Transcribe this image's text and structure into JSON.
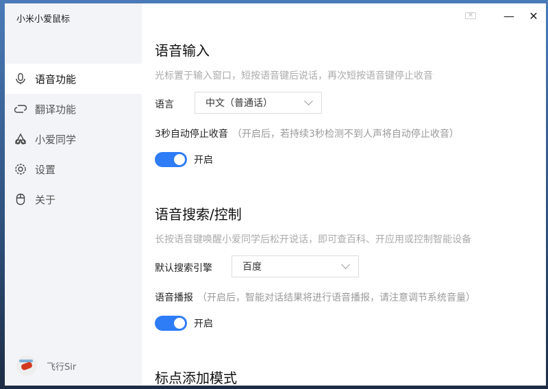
{
  "app_title": "小米小爱鼠标",
  "sidebar": {
    "items": [
      {
        "label": "语音功能",
        "icon": "microphone-icon",
        "active": true
      },
      {
        "label": "翻译功能",
        "icon": "loop-icon"
      },
      {
        "label": "小爱同学",
        "icon": "xiaoai-icon"
      },
      {
        "label": "设置",
        "icon": "gear-icon"
      },
      {
        "label": "关于",
        "icon": "mouse-icon"
      }
    ],
    "user": "飞行Sir"
  },
  "window_controls": {
    "battery": "✕",
    "minimize": "—",
    "close": "✕"
  },
  "voice_input": {
    "title": "语音输入",
    "desc": "光标置于输入窗口，短按语音键后说话，再次短按语音键停止收音",
    "language_label": "语言",
    "language_value": "中文（普通话）",
    "auto_stop_label": "3秒自动停止收音",
    "auto_stop_note": "（开启后，若持续3秒检测不到人声将自动停止收音）",
    "toggle_label": "开启",
    "toggle_on": true
  },
  "voice_search": {
    "title": "语音搜索/控制",
    "desc": "长按语音键唤醒小爱同学后松开说话，即可查百科、开应用或控制智能设备",
    "engine_label": "默认搜索引擎",
    "engine_value": "百度",
    "broadcast_label": "语音播报",
    "broadcast_note": "（开启后，智能对话结果将进行语音播报，请注意调节系统音量）",
    "toggle_label": "开启",
    "toggle_on": true
  },
  "punctuation": {
    "title": "标点添加模式"
  },
  "colors": {
    "accent": "#2e7cf6",
    "sidebar_bg": "#f3f4f8"
  }
}
